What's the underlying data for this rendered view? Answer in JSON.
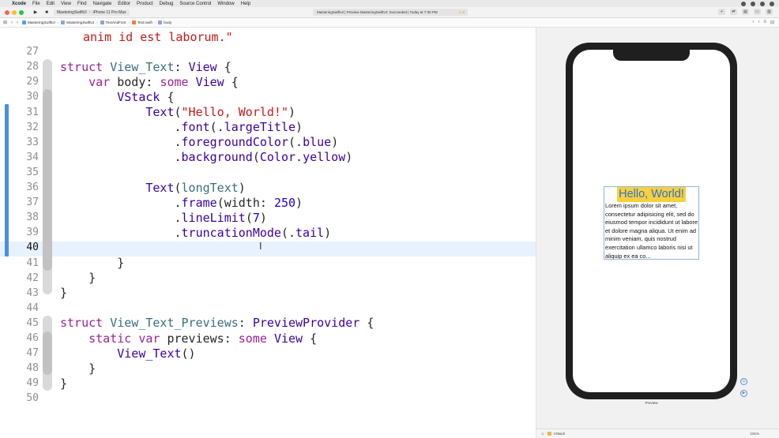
{
  "menubar": {
    "items": [
      "Xcode",
      "File",
      "Edit",
      "View",
      "Find",
      "Navigate",
      "Editor",
      "Product",
      "Debug",
      "Source Control",
      "Window",
      "Help"
    ]
  },
  "toolbar": {
    "scheme_target": "MasteringSwiftUI",
    "scheme_device": "iPhone 11 Pro Max",
    "activity_text": "MasteringSwiftUI | Preview MasteringSwiftUI: Succeeded | Today at 7:30 PM",
    "warning_count": "2"
  },
  "jumpbar": {
    "crumbs": [
      "MasteringSwiftUI",
      "MasteringSwiftUI",
      "TextAndFont",
      "Text.swift",
      "body"
    ]
  },
  "editor": {
    "current_line": "40",
    "lines": [
      {
        "n": "",
        "tokens": [
          {
            "t": "str",
            "v": "anim id est laborum.\""
          }
        ],
        "indent": 1
      },
      {
        "n": "27",
        "tokens": []
      },
      {
        "n": "28",
        "tokens": [
          {
            "t": "kw",
            "v": "struct "
          },
          {
            "t": "ty",
            "v": "View_Text"
          },
          {
            "t": "prm",
            "v": ": "
          },
          {
            "t": "fn",
            "v": "View"
          },
          {
            "t": "prm",
            "v": " {"
          }
        ]
      },
      {
        "n": "29",
        "tokens": [
          {
            "t": "prm",
            "v": "    "
          },
          {
            "t": "kw",
            "v": "var "
          },
          {
            "t": "prm",
            "v": "body: "
          },
          {
            "t": "kw",
            "v": "some "
          },
          {
            "t": "fn",
            "v": "View"
          },
          {
            "t": "prm",
            "v": " {"
          }
        ]
      },
      {
        "n": "30",
        "tokens": [
          {
            "t": "prm",
            "v": "        "
          },
          {
            "t": "fn",
            "v": "VStack"
          },
          {
            "t": "prm",
            "v": " {"
          }
        ]
      },
      {
        "n": "31",
        "tokens": [
          {
            "t": "prm",
            "v": "            "
          },
          {
            "t": "fn",
            "v": "Text"
          },
          {
            "t": "prm",
            "v": "("
          },
          {
            "t": "str",
            "v": "\"Hello, World!\""
          },
          {
            "t": "prm",
            "v": ")"
          }
        ]
      },
      {
        "n": "32",
        "tokens": [
          {
            "t": "prm",
            "v": "                ."
          },
          {
            "t": "fn",
            "v": "font"
          },
          {
            "t": "prm",
            "v": "(."
          },
          {
            "t": "fn",
            "v": "largeTitle"
          },
          {
            "t": "prm",
            "v": ")"
          }
        ]
      },
      {
        "n": "33",
        "tokens": [
          {
            "t": "prm",
            "v": "                ."
          },
          {
            "t": "fn",
            "v": "foregroundColor"
          },
          {
            "t": "prm",
            "v": "(."
          },
          {
            "t": "fn",
            "v": "blue"
          },
          {
            "t": "prm",
            "v": ")"
          }
        ]
      },
      {
        "n": "34",
        "tokens": [
          {
            "t": "prm",
            "v": "                ."
          },
          {
            "t": "fn",
            "v": "background"
          },
          {
            "t": "prm",
            "v": "("
          },
          {
            "t": "fn",
            "v": "Color"
          },
          {
            "t": "prm",
            "v": "."
          },
          {
            "t": "fn",
            "v": "yellow"
          },
          {
            "t": "prm",
            "v": ")"
          }
        ]
      },
      {
        "n": "35",
        "tokens": []
      },
      {
        "n": "36",
        "tokens": [
          {
            "t": "prm",
            "v": "            "
          },
          {
            "t": "fn",
            "v": "Text"
          },
          {
            "t": "prm",
            "v": "("
          },
          {
            "t": "ty",
            "v": "longText"
          },
          {
            "t": "prm",
            "v": ")"
          }
        ]
      },
      {
        "n": "37",
        "tokens": [
          {
            "t": "prm",
            "v": "                ."
          },
          {
            "t": "fn",
            "v": "frame"
          },
          {
            "t": "prm",
            "v": "(width: "
          },
          {
            "t": "num",
            "v": "250"
          },
          {
            "t": "prm",
            "v": ")"
          }
        ]
      },
      {
        "n": "38",
        "tokens": [
          {
            "t": "prm",
            "v": "                ."
          },
          {
            "t": "fn",
            "v": "lineLimit"
          },
          {
            "t": "prm",
            "v": "("
          },
          {
            "t": "num",
            "v": "7"
          },
          {
            "t": "prm",
            "v": ")"
          }
        ]
      },
      {
        "n": "39",
        "tokens": [
          {
            "t": "prm",
            "v": "                ."
          },
          {
            "t": "fn",
            "v": "truncationMode"
          },
          {
            "t": "prm",
            "v": "(."
          },
          {
            "t": "fn",
            "v": "tail"
          },
          {
            "t": "prm",
            "v": ")"
          }
        ]
      },
      {
        "n": "40",
        "tokens": []
      },
      {
        "n": "41",
        "tokens": [
          {
            "t": "prm",
            "v": "        }"
          }
        ]
      },
      {
        "n": "42",
        "tokens": [
          {
            "t": "prm",
            "v": "    }"
          }
        ]
      },
      {
        "n": "43",
        "tokens": [
          {
            "t": "prm",
            "v": "}"
          }
        ]
      },
      {
        "n": "44",
        "tokens": []
      },
      {
        "n": "45",
        "tokens": [
          {
            "t": "kw",
            "v": "struct "
          },
          {
            "t": "ty",
            "v": "View_Text_Previews"
          },
          {
            "t": "prm",
            "v": ": "
          },
          {
            "t": "fn",
            "v": "PreviewProvider"
          },
          {
            "t": "prm",
            "v": " {"
          }
        ]
      },
      {
        "n": "46",
        "tokens": [
          {
            "t": "prm",
            "v": "    "
          },
          {
            "t": "kw",
            "v": "static var "
          },
          {
            "t": "prm",
            "v": "previews: "
          },
          {
            "t": "kw",
            "v": "some "
          },
          {
            "t": "fn",
            "v": "View"
          },
          {
            "t": "prm",
            "v": " {"
          }
        ]
      },
      {
        "n": "47",
        "tokens": [
          {
            "t": "prm",
            "v": "        "
          },
          {
            "t": "fn",
            "v": "View_Text"
          },
          {
            "t": "prm",
            "v": "()"
          }
        ]
      },
      {
        "n": "48",
        "tokens": [
          {
            "t": "prm",
            "v": "    }"
          }
        ]
      },
      {
        "n": "49",
        "tokens": [
          {
            "t": "prm",
            "v": "}"
          }
        ]
      },
      {
        "n": "50",
        "tokens": []
      }
    ]
  },
  "preview": {
    "hello_text": "Hello, World!",
    "long_text": "Lorem ipsum dolor sit amet, consectetur adipisicing elit, sed do eiusmod tempor incididunt ut labore et dolore magna aliqua. Ut enim ad minim veniam, quis nostrud exercitation ullamco laboris nisi ut aliquip ex ea co...",
    "device_label": "Preview",
    "bottom_label": "VStack",
    "zoom": "101%"
  },
  "colors": {
    "keyword": "#9b2393",
    "type": "#3a6d81",
    "string": "#c41a16",
    "function": "#3900a0",
    "number": "#1c00cf",
    "change_bar": "#4a90e2",
    "highlight_yellow": "#f7d03c",
    "text_blue": "#2f6fd6"
  }
}
